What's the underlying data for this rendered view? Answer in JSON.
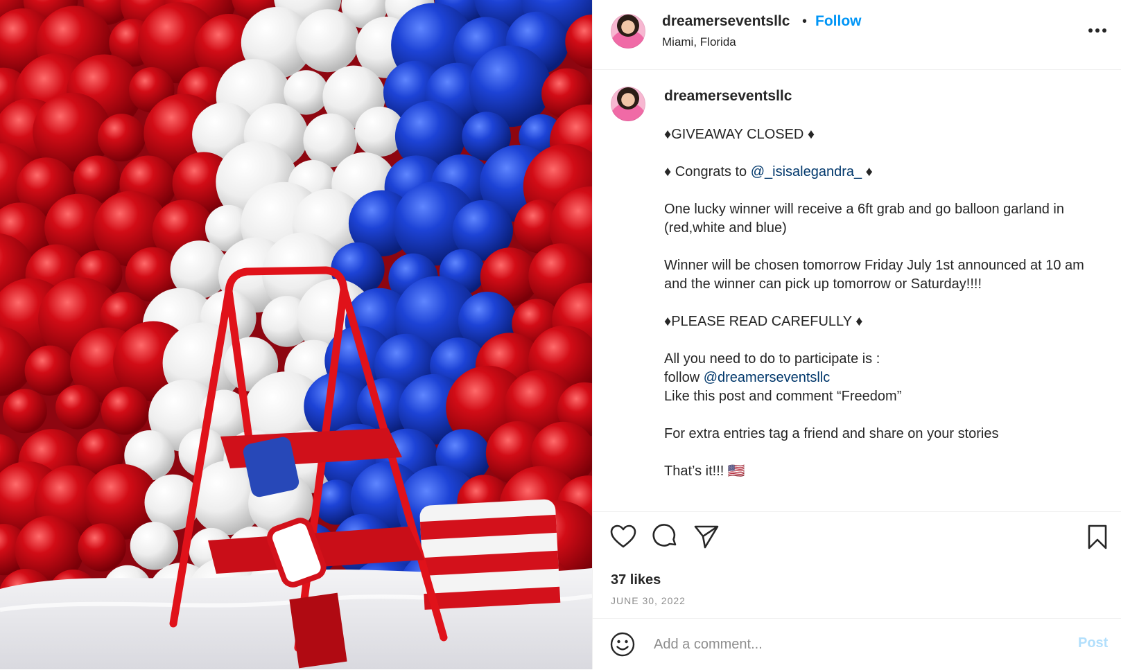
{
  "post": {
    "image_alt": "Red, white and blue balloon garland backdrop with a red step ladder",
    "colors": {
      "balloon_red": "#c40713",
      "balloon_white": "#f2f2f2",
      "balloon_blue": "#1c3fd0",
      "ladder_red": "#e0121a"
    }
  },
  "header": {
    "username": "dreamerseventsllc",
    "separator": "•",
    "follow_label": "Follow",
    "location": "Miami, Florida",
    "more_icon": "more-horizontal-icon"
  },
  "caption": {
    "username": "dreamerseventsllc",
    "username_suffix": "⠀⠀⠀⠀⠀⠀⠀⠀⠀⠀",
    "spacer": "⠀⠀⠀⠀⠀⠀⠀⠀⠀⠀",
    "line1": "♦GIVEAWAY CLOSED ♦",
    "line2_prefix": "♦ Congrats to ",
    "line2_mention": "@_isisalegandra_",
    "line2_suffix": " ♦",
    "line3": "One lucky winner will receive a 6ft grab and go balloon garland in (red,white and blue)",
    "line4": "Winner will be chosen tomorrow Friday July 1st announced at 10 am and the winner can pick up tomorrow or Saturday!!!!",
    "line5": "♦PLEASE READ CAREFULLY ♦",
    "line6": "All you need to do to participate is :",
    "line7_prefix": "follow ",
    "line7_mention": "@dreamerseventsllc",
    "line8": "Like this post and comment “Freedom”",
    "line9": "For extra entries tag a friend and share on your stories",
    "line10": "That’s it!!! 🇺🇸"
  },
  "actions": {
    "like_icon": "heart-icon",
    "comment_icon": "comment-icon",
    "share_icon": "send-icon",
    "save_icon": "bookmark-icon",
    "likes": "37 likes",
    "date": "JUNE 30, 2022"
  },
  "comment": {
    "emoji_icon": "emoji-icon",
    "placeholder": "Add a comment...",
    "post_label": "Post",
    "post_color": "#b2dffc"
  }
}
